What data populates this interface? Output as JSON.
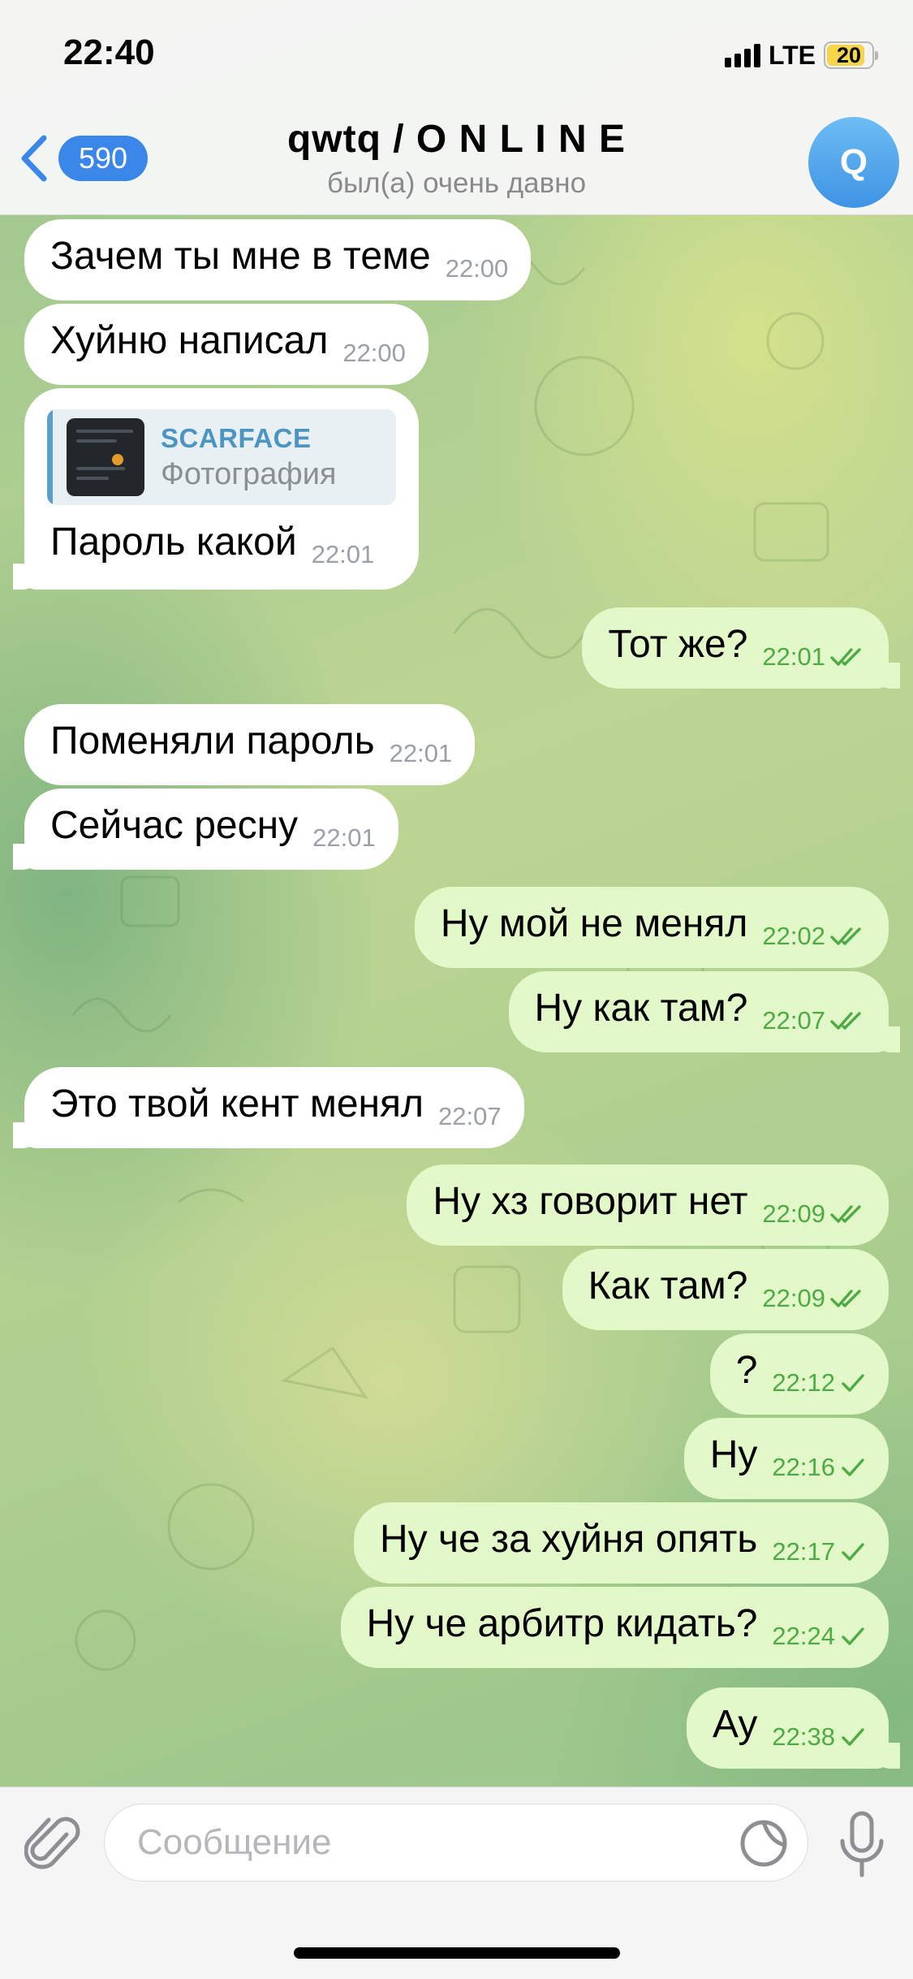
{
  "status_bar": {
    "time": "22:40",
    "network": "LTE",
    "battery": "20"
  },
  "header": {
    "back_count": "590",
    "title": "qwtq / O N L I N E",
    "status": "был(а) очень давно",
    "avatar_letter": "Q"
  },
  "messages": [
    {
      "dir": "in",
      "text": "Зачем ты мне в теме",
      "time": "22:00"
    },
    {
      "dir": "in",
      "text": "Хуйню написал",
      "time": "22:00"
    },
    {
      "dir": "in",
      "text": "Пароль какой",
      "time": "22:01",
      "reply": {
        "name": "SCARFACE",
        "sub": "Фотография"
      }
    },
    {
      "dir": "out",
      "text": "Тот же?",
      "time": "22:01",
      "status": "read"
    },
    {
      "dir": "in",
      "text": "Поменяли пароль",
      "time": "22:01"
    },
    {
      "dir": "in",
      "text": "Сейчас ресну",
      "time": "22:01"
    },
    {
      "dir": "out",
      "text": "Ну мой не менял",
      "time": "22:02",
      "status": "read"
    },
    {
      "dir": "out",
      "text": "Ну как там?",
      "time": "22:07",
      "status": "read"
    },
    {
      "dir": "in",
      "text": "Это твой кент менял",
      "time": "22:07"
    },
    {
      "dir": "out",
      "text": "Ну хз говорит нет",
      "time": "22:09",
      "status": "read"
    },
    {
      "dir": "out",
      "text": "Как там?",
      "time": "22:09",
      "status": "read"
    },
    {
      "dir": "out",
      "text": "?",
      "time": "22:12",
      "status": "sent"
    },
    {
      "dir": "out",
      "text": "Ну",
      "time": "22:16",
      "status": "sent"
    },
    {
      "dir": "out",
      "text": "Ну че за хуйня опять",
      "time": "22:17",
      "status": "sent"
    },
    {
      "dir": "out",
      "text": "Ну че арбитр кидать?",
      "time": "22:24",
      "status": "sent"
    },
    {
      "dir": "out",
      "text": "Ау",
      "time": "22:38",
      "status": "sent"
    }
  ],
  "input": {
    "placeholder": "Сообщение"
  },
  "colors": {
    "incoming_bubble": "#ffffff",
    "outgoing_bubble": "#e3f8c9",
    "outgoing_meta": "#4eab44",
    "accent": "#3a86e9"
  },
  "icons": {
    "back": "chevron-left-icon",
    "read": "double-check-icon",
    "sent": "check-icon",
    "attach": "paperclip-icon",
    "sticker": "sticker-icon",
    "mic": "microphone-icon"
  }
}
